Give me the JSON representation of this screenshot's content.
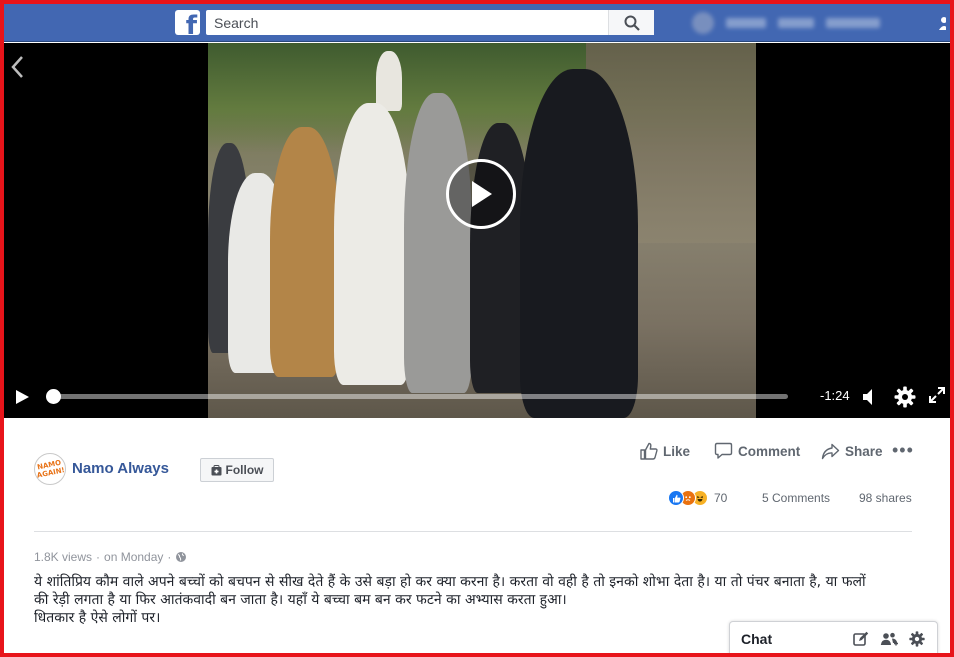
{
  "topbar": {
    "search_placeholder": "Search",
    "logo_letter": "f"
  },
  "video": {
    "time_remaining": "-1:24",
    "progress_fraction": 0.0
  },
  "post": {
    "page_name": "Namo Always",
    "avatar_text": "NAMO AGAIN!",
    "follow_label": "Follow",
    "actions": {
      "like": "Like",
      "comment": "Comment",
      "share": "Share"
    },
    "reaction_count": "70",
    "comments_count": "5 Comments",
    "shares_count": "98 shares",
    "views": "1.8K views",
    "separator": "·",
    "posted": "on Monday",
    "caption_lines": [
      "ये शांतिप्रिय कौम वाले अपने बच्चों को बचपन से सीख देते हैं के उसे बड़ा हो कर क्या करना है। करता वो वही है तो इनको शोभा देता है। या तो पंचर बनाता है, या फलों",
      "की रेड़ी लगता है या फिर आतंकवादी बन जाता है। यहाँ ये बच्चा बम बन कर फटने का अभ्यास करता हुआ।",
      "धितकार है ऐसे लोगों पर।"
    ]
  },
  "chat": {
    "label": "Chat"
  },
  "colors": {
    "facebook_blue": "#4267b2",
    "link_blue": "#365899",
    "frame_red": "#e8141a",
    "like_blue": "#1877f2",
    "angry_orange": "#e9710f",
    "haha_yellow": "#f7b125"
  }
}
